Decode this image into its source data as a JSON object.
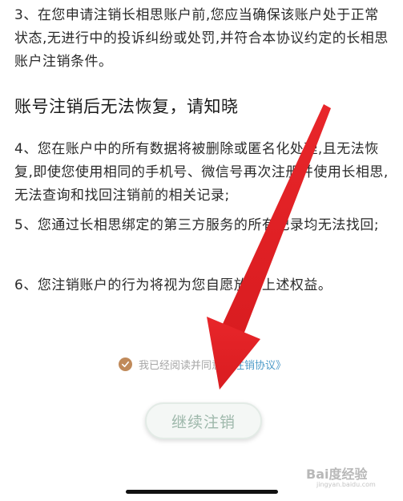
{
  "terms": {
    "p3": "3、在您申请注销长相思账户前,您应当确保该账户处于正常状态,无进行中的投诉纠纷或处罚,并符合本协议约定的长相思账户注销条件。",
    "heading": "账号注销后无法恢复，请知晓",
    "p4": "4、您在账户中的所有数据将被删除或匿名化处理,且无法恢复,即使您使用相同的手机号、微信号再次注册并使用长相思,无法查询和找回注销前的相关记录;",
    "p5": "5、您通过长相思绑定的第三方服务的所有记录均无法找回;",
    "p6": "6、您注销账户的行为将视为您自愿放弃上述权益。"
  },
  "agreement": {
    "prefix": "我已经阅读并同意",
    "link": "《注销协议》",
    "checked": true,
    "check_color": "#c08a5a",
    "link_color": "#4e9bc8"
  },
  "continue_button": {
    "label": "继续注销"
  },
  "annotation": {
    "arrow_color": "#e8262a",
    "arrow_icon": "red-arrow-icon"
  },
  "watermark": {
    "text": "Bai度经验",
    "sub": "jingyan.baidu.com"
  }
}
